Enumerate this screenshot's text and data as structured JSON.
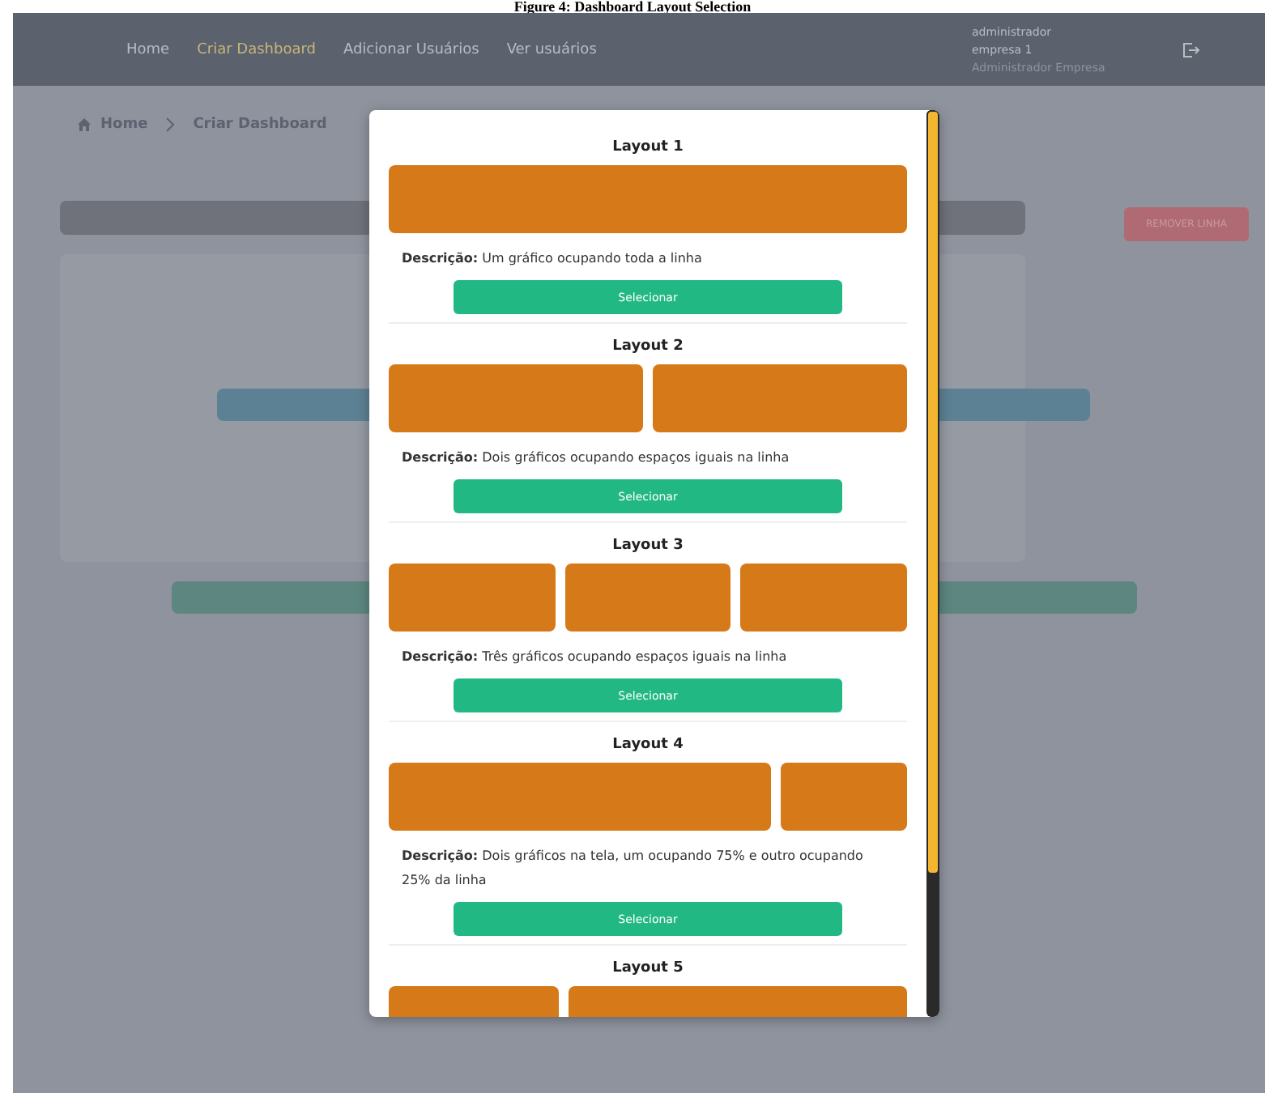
{
  "caption": "Figure 4: Dashboard Layout Selection",
  "nav": {
    "links": [
      {
        "label": "Home",
        "selected": false
      },
      {
        "label": "Criar Dashboard",
        "selected": true
      },
      {
        "label": "Adicionar Usuários",
        "selected": false
      },
      {
        "label": "Ver usuários",
        "selected": false
      }
    ],
    "user": {
      "name": "administrador",
      "company": "empresa 1",
      "role": "Administrador Empresa"
    }
  },
  "breadcrumb": [
    "Home",
    "Criar Dashboard"
  ],
  "background": {
    "remove_button": "REMOVER LINHA"
  },
  "modal": {
    "layouts": [
      {
        "title": "Layout 1",
        "blocks": [
          {
            "kind": "full"
          }
        ],
        "label": "Descrição:",
        "description": "Um gráfico ocupando toda a linha",
        "button": "Selecionar"
      },
      {
        "title": "Layout 2",
        "blocks": [
          {
            "kind": "half"
          },
          {
            "kind": "half"
          }
        ],
        "label": "Descrição:",
        "description": "Dois gráficos ocupando espaços iguais na linha",
        "button": "Selecionar"
      },
      {
        "title": "Layout 3",
        "blocks": [
          {
            "kind": "third"
          },
          {
            "kind": "third"
          },
          {
            "kind": "third"
          }
        ],
        "label": "Descrição:",
        "description": "Três gráficos ocupando espaços iguais na linha",
        "button": "Selecionar"
      },
      {
        "title": "Layout 4",
        "blocks": [
          {
            "kind": "three-quarters"
          },
          {
            "kind": "quarter"
          }
        ],
        "label": "Descrição:",
        "description": "Dois gráficos na tela, um ocupando 75% e outro ocupando 25% da linha",
        "button": "Selecionar"
      },
      {
        "title": "Layout 5",
        "blocks": [
          {
            "kind": "third"
          },
          {
            "kind": "two-thirds"
          }
        ]
      }
    ]
  }
}
